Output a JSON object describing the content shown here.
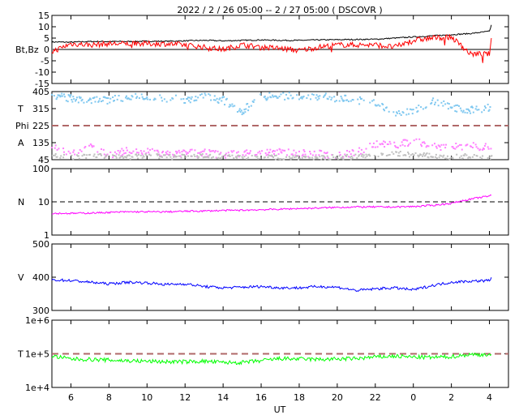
{
  "chart_data": {
    "type": "line",
    "title": "2022 /  2 / 26   05:00 --  2 / 27   05:00 ( DSCOVR )",
    "xlabel": "UT",
    "x_hours_from_start": [
      0,
      1,
      2,
      3,
      4,
      5,
      6,
      7,
      8,
      9,
      10,
      11,
      12,
      13,
      14,
      15,
      16,
      17,
      18,
      19,
      20,
      21,
      22,
      23,
      23.15
    ],
    "x_ticks": [
      "6",
      "8",
      "10",
      "12",
      "14",
      "16",
      "18",
      "20",
      "22",
      "0",
      "2",
      "4"
    ],
    "x_range_hours": [
      0,
      24
    ],
    "panels": [
      {
        "name": "mag",
        "ylabel": "Bt,Bz",
        "ylim": [
          -15,
          15
        ],
        "scale": "linear",
        "ticks": [
          "15",
          "10",
          "5",
          "0",
          "-5",
          "-10",
          "-15"
        ],
        "tick_values": [
          15,
          10,
          5,
          0,
          -5,
          -10,
          -15
        ],
        "ref_line": 0,
        "series": [
          {
            "name": "Bt",
            "color": "#000000",
            "values": [
              3.3,
              3.2,
              3.5,
              3.5,
              3.5,
              3.6,
              3.6,
              3.8,
              4.0,
              3.8,
              4.0,
              4.2,
              4.0,
              4.0,
              4.2,
              4.3,
              4.4,
              4.5,
              5.0,
              5.5,
              6.0,
              6.5,
              7.0,
              8.0,
              12.0
            ]
          },
          {
            "name": "Bz",
            "color": "#ff0000",
            "values": [
              -1,
              2.5,
              2.0,
              2.5,
              2.5,
              2.5,
              2.5,
              2.0,
              1.0,
              0.0,
              2.0,
              1.0,
              0.5,
              -0.5,
              1.0,
              2.0,
              2.0,
              2.0,
              1.0,
              4.0,
              5.0,
              5.5,
              -2.0,
              -2.0,
              8.0
            ]
          }
        ]
      },
      {
        "name": "phi",
        "ylabel_lines": [
          "T",
          "Phi",
          "A"
        ],
        "ylim": [
          45,
          405
        ],
        "scale": "linear",
        "ticks": [
          "405",
          "315",
          "225",
          "135",
          "45"
        ],
        "tick_values": [
          405,
          315,
          225,
          135,
          45
        ],
        "ref_line": 225,
        "series": [
          {
            "name": "Phi-A",
            "color": "#ff80ff",
            "values": [
              120,
              80,
              110,
              70,
              90,
              85,
              75,
              80,
              80,
              70,
              80,
              80,
              85,
              80,
              75,
              70,
              80,
              130,
              120,
              140,
              120,
              110,
              120,
              110,
              70
            ]
          },
          {
            "name": "Phi-T",
            "color": "#80c8f0",
            "values": [
              380,
              370,
              360,
              360,
              380,
              370,
              370,
              360,
              380,
              360,
              300,
              380,
              380,
              380,
              380,
              370,
              360,
              350,
              280,
              300,
              360,
              320,
              310,
              320,
              320
            ]
          },
          {
            "name": "Phi-other",
            "color": "#c0c0c0",
            "values": [
              70,
              60,
              60,
              65,
              60,
              65,
              60,
              60,
              65,
              60,
              55,
              60,
              55,
              60,
              55,
              60,
              60,
              70,
              80,
              70,
              65,
              60,
              65,
              60,
              65
            ]
          }
        ]
      },
      {
        "name": "density",
        "ylabel": "N",
        "ylim": [
          1,
          100
        ],
        "scale": "log",
        "ticks": [
          "100",
          "10",
          "1"
        ],
        "tick_values": [
          100,
          10,
          1
        ],
        "ref_line": 10,
        "series": [
          {
            "name": "N",
            "color": "#ff00ff",
            "values": [
              4.5,
              4.5,
              4.6,
              4.8,
              5.0,
              5.0,
              5.0,
              5.2,
              5.3,
              5.5,
              5.6,
              5.8,
              6.0,
              6.3,
              6.5,
              6.8,
              7.0,
              7.0,
              7.0,
              7.2,
              7.8,
              9.0,
              12.0,
              15.0,
              16.0
            ]
          }
        ]
      },
      {
        "name": "speed",
        "ylabel": "V",
        "ylim": [
          300,
          500
        ],
        "scale": "linear",
        "ticks": [
          "500",
          "400",
          "300"
        ],
        "tick_values": [
          500,
          400,
          300
        ],
        "series": [
          {
            "name": "V",
            "color": "#0000ff",
            "values": [
              392,
              390,
              385,
              380,
              385,
              383,
              378,
              380,
              372,
              368,
              370,
              372,
              368,
              368,
              372,
              370,
              360,
              365,
              368,
              362,
              375,
              385,
              388,
              390,
              404
            ]
          }
        ]
      },
      {
        "name": "temperature",
        "ylabel": "T",
        "ylim": [
          10000,
          1000000
        ],
        "scale": "log",
        "ticks": [
          "1e+6",
          "1e+5",
          "1e+4"
        ],
        "tick_values": [
          1000000,
          100000,
          10000
        ],
        "ref_line": 100000,
        "series": [
          {
            "name": "T",
            "color": "#00ff00",
            "values": [
              85000,
              70000,
              68000,
              65000,
              62000,
              60000,
              58000,
              58000,
              60000,
              55000,
              55000,
              62000,
              72000,
              70000,
              68000,
              70000,
              72000,
              80000,
              85000,
              80000,
              78000,
              82000,
              95000,
              95000,
              78000
            ]
          }
        ]
      }
    ]
  },
  "colors": {
    "ref_dash": "#b06868",
    "axis": "#000000",
    "zero": "#808080"
  }
}
